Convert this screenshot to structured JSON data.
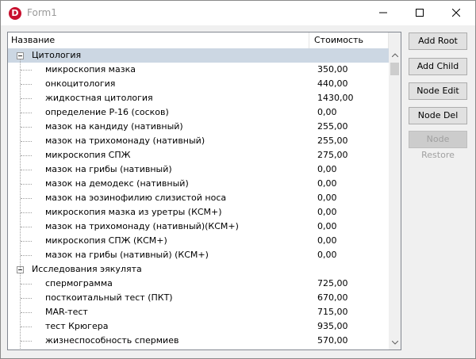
{
  "window": {
    "title": "Form1",
    "icon_letter": "D"
  },
  "tree": {
    "columns": {
      "name": "Название",
      "cost": "Стоимость"
    },
    "rows": [
      {
        "kind": "group",
        "label": "Цитология",
        "cost": "",
        "selected": true
      },
      {
        "kind": "item",
        "label": "микроскопия мазка",
        "cost": "350,00"
      },
      {
        "kind": "item",
        "label": "онкоцитология",
        "cost": "440,00"
      },
      {
        "kind": "item",
        "label": "жидкостная цитология",
        "cost": "1430,00"
      },
      {
        "kind": "item",
        "label": "определение Р-16 (сосков)",
        "cost": "0,00"
      },
      {
        "kind": "item",
        "label": "мазок на кандиду (нативный)",
        "cost": "255,00"
      },
      {
        "kind": "item",
        "label": "мазок на трихомонаду (нативный)",
        "cost": "255,00"
      },
      {
        "kind": "item",
        "label": "микроскопия СПЖ",
        "cost": "275,00"
      },
      {
        "kind": "item",
        "label": "мазок на грибы (нативный)",
        "cost": "0,00"
      },
      {
        "kind": "item",
        "label": "мазок на демодекс (нативный)",
        "cost": "0,00"
      },
      {
        "kind": "item",
        "label": "мазок на эозинофилию слизистой носа",
        "cost": "0,00"
      },
      {
        "kind": "item",
        "label": "микроскопия мазка из уретры (КСМ+)",
        "cost": "0,00"
      },
      {
        "kind": "item",
        "label": "мазок на трихомонаду (нативный)(КСМ+)",
        "cost": "0,00"
      },
      {
        "kind": "item",
        "label": "микроскопия СПЖ (КСМ+)",
        "cost": "0,00"
      },
      {
        "kind": "item",
        "label": "мазок на грибы (нативный) (КСМ+)",
        "cost": "0,00"
      },
      {
        "kind": "group",
        "label": "Исследования эякулята",
        "cost": "",
        "selected": false
      },
      {
        "kind": "item",
        "label": "спермограмма",
        "cost": "725,00"
      },
      {
        "kind": "item",
        "label": "посткоитальный тест (ПКТ)",
        "cost": "670,00"
      },
      {
        "kind": "item",
        "label": "MAR-тест",
        "cost": "715,00"
      },
      {
        "kind": "item",
        "label": "тест Крюгера",
        "cost": "935,00"
      },
      {
        "kind": "item",
        "label": "жизнеспособность спермиев",
        "cost": "570,00"
      }
    ]
  },
  "buttons": {
    "add_root": "Add Root",
    "add_child": "Add Child",
    "node_edit": "Node Edit",
    "node_del": "Node Del",
    "node_restore": "Node Restore"
  },
  "colors": {
    "selection": "#ccd7e3",
    "icon": "#c8102e"
  }
}
